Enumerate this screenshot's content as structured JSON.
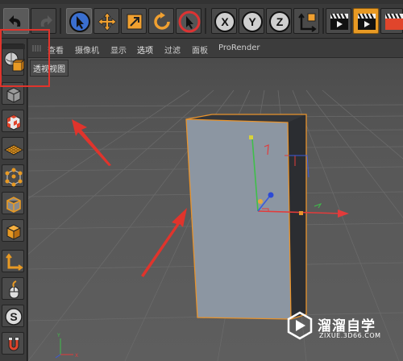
{
  "viewport": {
    "menu": [
      "查看",
      "摄像机",
      "显示",
      "选项",
      "过滤",
      "面板",
      "ProRender"
    ],
    "active_menu": "选项",
    "name": "透视视图"
  },
  "axis_labels": {
    "x": "X",
    "y": "Y",
    "z": "Z"
  },
  "watermark": {
    "title": "溜溜自学",
    "url": "ZIXUE.3D66.COM"
  },
  "icons": {
    "toolbar": [
      "undo-icon",
      "redo-icon",
      "select-cursor-icon",
      "move-icon",
      "scale-icon",
      "rotate-icon",
      "live-select-icon",
      "x-axis-lock-icon",
      "y-axis-lock-icon",
      "z-axis-lock-icon",
      "coordinate-system-icon",
      "render-view-icon",
      "render-picture-viewer-icon",
      "render-settings-icon"
    ],
    "left": [
      "mode-toggle-icon",
      "model-mode-icon",
      "texture-mode-icon",
      "workplane-mode-icon",
      "point-mode-icon",
      "edge-mode-icon",
      "polygon-mode-icon",
      "axis-mode-icon",
      "tweak-mode-icon",
      "snap-icon",
      "magnet-icon"
    ]
  },
  "colors": {
    "selection_outline": "#e8932c",
    "annotation_red": "#e0342c",
    "axis_x": "#e33b3b",
    "axis_y": "#3fbf4a",
    "axis_z": "#3b5bdb",
    "accent_orange": "#e89a24"
  }
}
